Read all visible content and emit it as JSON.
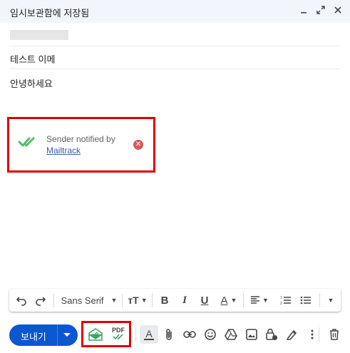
{
  "header": {
    "title": "임시보관함에 저장됨",
    "minimize_icon": "minimize-icon",
    "expand_icon": "expand-icon",
    "close_icon": "close-icon"
  },
  "compose": {
    "subject": "테스트 이메",
    "body": "안녕하세요"
  },
  "mailtrack": {
    "text": "Sender notified by",
    "link": "Mailtrack",
    "status_color": "#4cbf6b",
    "remove_color": "#d45a5a"
  },
  "format_toolbar": {
    "font_name": "Sans Serif",
    "undo_icon": "undo-icon",
    "redo_icon": "redo-icon",
    "size_icon": "text-size-icon",
    "bold": "B",
    "italic": "I",
    "underline": "U",
    "text_color": "A",
    "align_icon": "align-icon",
    "numbered_list_icon": "numbered-list-icon",
    "bulleted_list_icon": "bulleted-list-icon",
    "more_icon": "more-formatting-icon"
  },
  "bottom_bar": {
    "send_label": "보내기",
    "pdf_label": "PDF",
    "format_label": "A",
    "accent_color": "#0b57d0"
  }
}
